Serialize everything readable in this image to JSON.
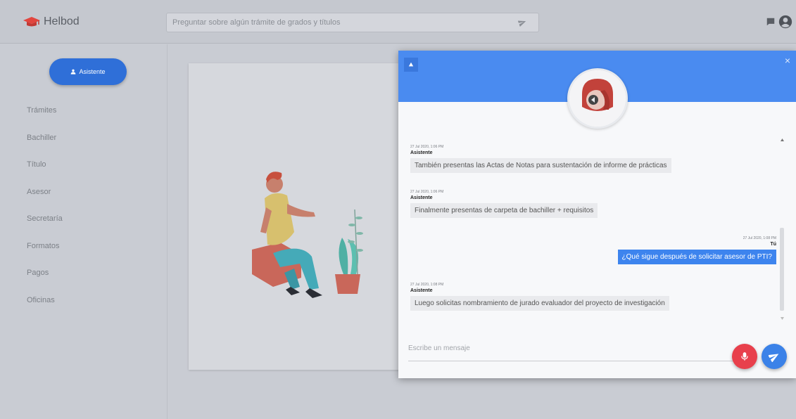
{
  "app": {
    "title": "Helbod"
  },
  "search": {
    "placeholder": "Preguntar sobre algún trámite de grados y títulos"
  },
  "sidebar": {
    "assistant_label": "Asistente",
    "items": [
      {
        "label": "Trámites"
      },
      {
        "label": "Bachiller"
      },
      {
        "label": "Título"
      },
      {
        "label": "Asesor"
      },
      {
        "label": "Secretaría"
      },
      {
        "label": "Formatos"
      },
      {
        "label": "Pagos"
      },
      {
        "label": "Oficinas"
      }
    ]
  },
  "chat": {
    "messages": [
      {
        "time": "27 Jul 2020, 1:06 PM",
        "sender": "Asistente",
        "text": "También presentas las Actas de Notas para sustentación de informe de prácticas",
        "from_user": false
      },
      {
        "time": "27 Jul 2020, 1:06 PM",
        "sender": "Asistente",
        "text": "Finalmente presentas de carpeta de bachiller + requisitos",
        "from_user": false
      },
      {
        "time": "27 Jul 2020, 1:08 PM",
        "sender": "Tú",
        "text": "¿Qué sigue después de solicitar asesor de PTI?",
        "from_user": true
      },
      {
        "time": "27 Jul 2020, 1:08 PM",
        "sender": "Asistente",
        "text": "Luego solicitas nombramiento de jurado evaluador del proyecto de investigación",
        "from_user": false
      }
    ],
    "input_placeholder": "Escribe un mensaje",
    "close_glyph": "×"
  },
  "colors": {
    "accent": "#4a8bf0",
    "user_bubble": "#3d84ee",
    "mic_button": "#e8404c",
    "send_button": "#3b82e8"
  },
  "icons": {
    "header": [
      "mortarboard-icon",
      "send-icon",
      "chat-icon",
      "user-circle-icon"
    ],
    "sidebar": [
      "user-icon"
    ],
    "chat": [
      "chevron-up-icon",
      "close-icon",
      "mic-icon",
      "send-icon"
    ]
  }
}
